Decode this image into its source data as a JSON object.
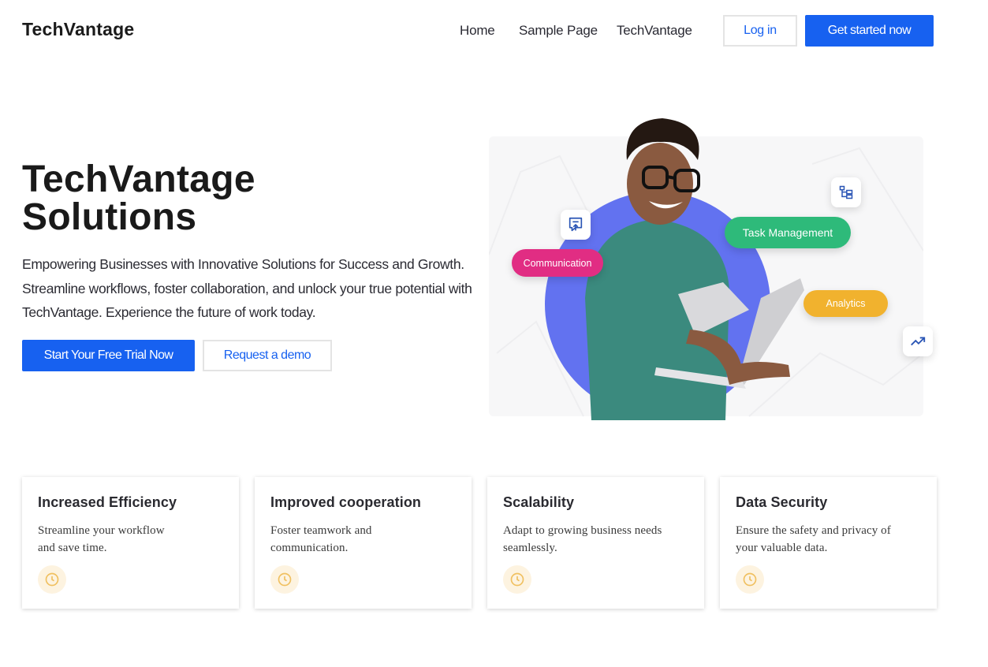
{
  "header": {
    "logo": "TechVantage",
    "nav": [
      "Home",
      "Sample Page",
      "TechVantage"
    ],
    "login_label": "Log in",
    "cta_label": "Get started now"
  },
  "hero": {
    "title_line1": "TechVantage",
    "title_line2": "Solutions",
    "description": "Empowering Businesses with Innovative Solutions for Success and Growth. Streamline workflows, foster collaboration, and unlock your true potential with TechVantage. Experience the future of work today.",
    "primary_button": "Start Your Free Trial Now",
    "secondary_button": "Request a demo",
    "tags": {
      "communication": "Communication",
      "task_management": "Task Management",
      "analytics": "Analytics"
    },
    "icons": [
      "chat-upload-icon",
      "hierarchy-icon",
      "trending-up-icon"
    ]
  },
  "features": [
    {
      "title": "Increased Efficiency",
      "text": "Streamline your workflow and save time.",
      "icon": "clock-icon"
    },
    {
      "title": "Improved cooperation",
      "text": "Foster teamwork and communication.",
      "icon": "clock-icon"
    },
    {
      "title": "Scalability",
      "text": "Adapt to growing business needs seamlessly.",
      "icon": "clock-icon"
    },
    {
      "title": "Data Security",
      "text": "Ensure the safety and privacy of your valuable data.",
      "icon": "clock-icon"
    }
  ],
  "colors": {
    "primary": "#1761f0",
    "communication": "#e12d83",
    "task": "#2eba7a",
    "analytics": "#f1b22e",
    "accent_circle": "#6272f0",
    "icon_gold": "#f0c060"
  }
}
